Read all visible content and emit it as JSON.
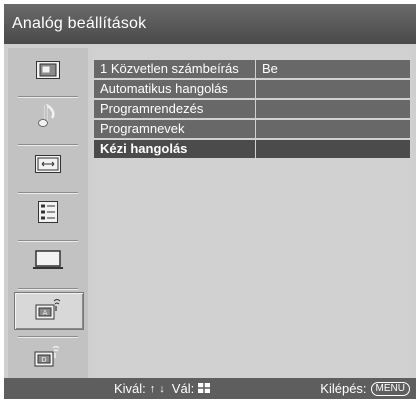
{
  "header": {
    "title": "Analóg beállítások"
  },
  "sidebar": {
    "items": [
      {
        "icon": "picture-icon",
        "selected": false
      },
      {
        "icon": "music-note-icon",
        "selected": false
      },
      {
        "icon": "screen-format-icon",
        "selected": false
      },
      {
        "icon": "features-list-icon",
        "selected": false
      },
      {
        "icon": "pc-monitor-icon",
        "selected": false
      },
      {
        "icon": "analog-setup-icon",
        "selected": true
      },
      {
        "icon": "digital-setup-icon",
        "selected": false
      }
    ]
  },
  "menu": {
    "items": [
      {
        "label": "1 Közvetlen számbeírás",
        "value": "Be",
        "active": false
      },
      {
        "label": "Automatikus hangolás",
        "value": "",
        "active": false
      },
      {
        "label": "Programrendezés",
        "value": "",
        "active": false
      },
      {
        "label": "Programnevek",
        "value": "",
        "active": false
      },
      {
        "label": "Kézi hangolás",
        "value": "",
        "active": true
      }
    ]
  },
  "footer": {
    "select_label": "Kivál:",
    "up_arrow": "↑",
    "down_arrow": "↓",
    "confirm_label": "Vál:",
    "exit_label": "Kilépés:",
    "menu_button": "MENU"
  }
}
